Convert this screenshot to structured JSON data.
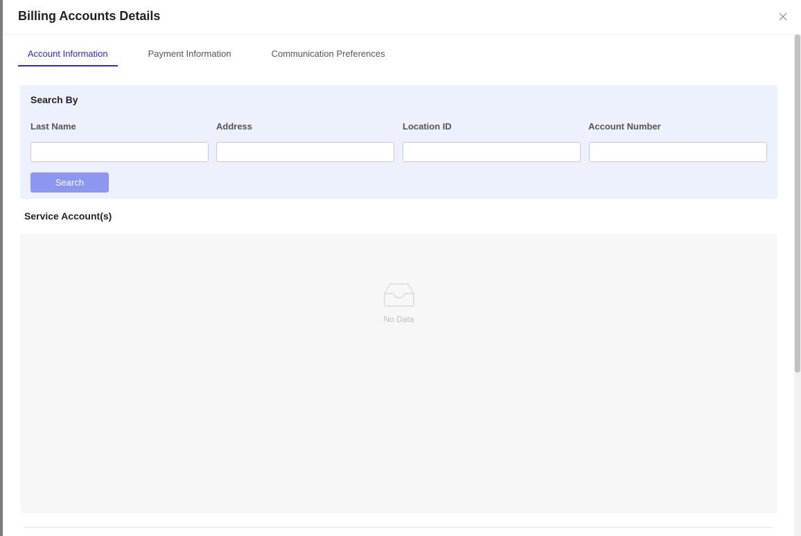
{
  "modal": {
    "title": "Billing Accounts Details",
    "close_label": "X"
  },
  "tabs": [
    {
      "label": "Account Information",
      "active": true
    },
    {
      "label": "Payment Information",
      "active": false
    },
    {
      "label": "Communication Preferences",
      "active": false
    }
  ],
  "search": {
    "title": "Search By",
    "fields": [
      {
        "label": "Last Name",
        "value": "",
        "placeholder": ""
      },
      {
        "label": "Address",
        "value": "",
        "placeholder": ""
      },
      {
        "label": "Location ID",
        "value": "",
        "placeholder": ""
      },
      {
        "label": "Account Number",
        "value": "",
        "placeholder": ""
      }
    ],
    "button_label": "Search"
  },
  "service_accounts": {
    "title": "Service Account(s)",
    "empty_text": "No Data",
    "empty_icon": "inbox-icon"
  },
  "colors": {
    "accent": "#2a2acc",
    "search_panel_bg": "#edf0fd",
    "search_button": "#8b97f0"
  }
}
